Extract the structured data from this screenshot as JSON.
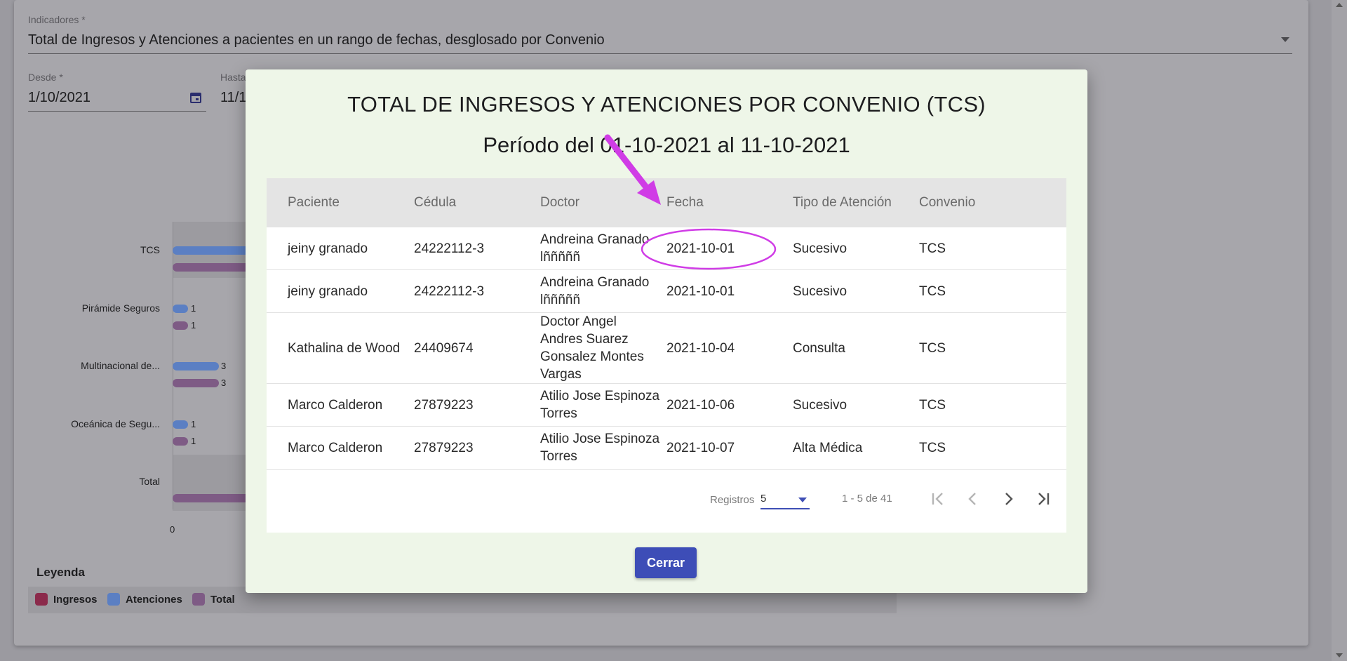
{
  "form": {
    "indicators_label": "Indicadores *",
    "indicators_value": "Total de Ingresos y Atenciones a pacientes en un rango de fechas, desglosado por Convenio",
    "from_label": "Desde *",
    "from_value": "1/10/2021",
    "to_label": "Hasta",
    "to_value": "11/1"
  },
  "chart": {
    "categories": [
      {
        "label": "TCS",
        "num_a": "",
        "num_b": ""
      },
      {
        "label": "Pirámide Seguros",
        "num_a": "1",
        "num_b": "1"
      },
      {
        "label": "Multinacional de...",
        "num_a": "3",
        "num_b": "3"
      },
      {
        "label": "Oceánica de Segu...",
        "num_a": "1",
        "num_b": "1"
      },
      {
        "label": "Total",
        "num_a": "",
        "num_b": ""
      }
    ],
    "x_tick": "0"
  },
  "chart_data": {
    "type": "bar",
    "orientation": "horizontal",
    "categories": [
      "TCS",
      "Pirámide Seguros",
      "Multinacional de...",
      "Oceánica de Segu...",
      "Total"
    ],
    "series": [
      {
        "name": "Atenciones",
        "values": [
          null,
          1,
          3,
          1,
          null
        ]
      },
      {
        "name": "Total",
        "values": [
          null,
          1,
          3,
          1,
          null
        ]
      }
    ],
    "x_ticks": [
      "0"
    ]
  },
  "legend": {
    "title": "Leyenda",
    "items": [
      {
        "label": "Ingresos",
        "color": "#8b2a4b"
      },
      {
        "label": "Atenciones",
        "color": "#5b7fc3"
      },
      {
        "label": "Total",
        "color": "#7e5b85"
      }
    ]
  },
  "modal": {
    "title": "TOTAL DE INGRESOS Y ATENCIONES POR CONVENIO (TCS)",
    "subtitle": "Período del 01-10-2021 al 11-10-2021",
    "columns": [
      "Paciente",
      "Cédula",
      "Doctor",
      "Fecha",
      "Tipo de Atención",
      "Convenio"
    ],
    "rows": [
      {
        "paciente": "jeiny granado",
        "cedula": "24222112-3",
        "doctor_lines": [
          "Andreina Granado",
          "lñññññ"
        ],
        "fecha": "2021-10-01",
        "tipo": "Sucesivo",
        "convenio": "TCS"
      },
      {
        "paciente": "jeiny granado",
        "cedula": "24222112-3",
        "doctor_lines": [
          "Andreina Granado",
          "lñññññ"
        ],
        "fecha": "2021-10-01",
        "tipo": "Sucesivo",
        "convenio": "TCS"
      },
      {
        "paciente": "Kathalina de Wood",
        "cedula": "24409674",
        "doctor_lines": [
          "Doctor Angel",
          "Andres Suarez",
          "Gonsalez Montes",
          "Vargas"
        ],
        "fecha": "2021-10-04",
        "tipo": "Consulta",
        "convenio": "TCS"
      },
      {
        "paciente": "Marco Calderon",
        "cedula": "27879223",
        "doctor_lines": [
          "Atilio Jose Espinoza",
          "Torres"
        ],
        "fecha": "2021-10-06",
        "tipo": "Sucesivo",
        "convenio": "TCS"
      },
      {
        "paciente": "Marco Calderon",
        "cedula": "27879223",
        "doctor_lines": [
          "Atilio Jose Espinoza",
          "Torres"
        ],
        "fecha": "2021-10-07",
        "tipo": "Alta Médica",
        "convenio": "TCS"
      }
    ],
    "paginator": {
      "label": "Registros",
      "page_size": "5",
      "range": "1 - 5 de 41"
    },
    "close_label": "Cerrar"
  },
  "colors": {
    "accent": "#3d4db7",
    "annotation": "#d03ce6"
  }
}
